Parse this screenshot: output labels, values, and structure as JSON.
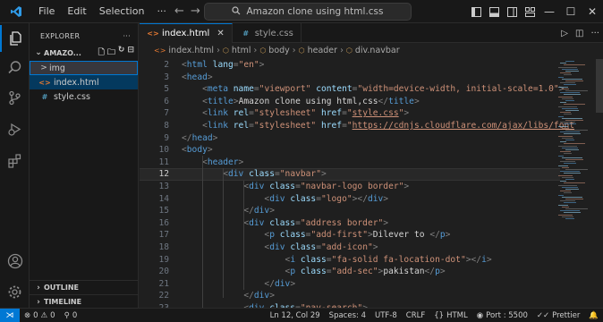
{
  "titlebar": {
    "menu": [
      "File",
      "Edit",
      "Selection"
    ],
    "more": "···",
    "search_text": "Amazon clone using html.css"
  },
  "sidebar": {
    "header": "EXPLORER",
    "more": "···",
    "folder": "AMAZO...",
    "tree": [
      {
        "label": "img",
        "type": "folder",
        "chevron": ">"
      },
      {
        "label": "index.html",
        "type": "html",
        "icon": "<>"
      },
      {
        "label": "style.css",
        "type": "css",
        "icon": "#"
      }
    ],
    "outline_label": "OUTLINE",
    "timeline_label": "TIMELINE"
  },
  "tabs": [
    {
      "label": "index.html",
      "icon": "<>",
      "active": true
    },
    {
      "label": "style.css",
      "icon": "#",
      "active": false
    }
  ],
  "breadcrumb": [
    "index.html",
    "html",
    "body",
    "header",
    "div.navbar"
  ],
  "code_lines": [
    {
      "n": "2",
      "tokens": [
        [
          "t",
          "<"
        ],
        [
          "g",
          "html "
        ],
        [
          "a",
          "lang"
        ],
        [
          "t",
          "="
        ],
        [
          "v",
          "\"en\""
        ],
        [
          "t",
          ">"
        ]
      ]
    },
    {
      "n": "3",
      "tokens": [
        [
          "t",
          "<"
        ],
        [
          "g",
          "head"
        ],
        [
          "t",
          ">"
        ]
      ]
    },
    {
      "n": "5",
      "tokens": [
        [
          "x",
          "    "
        ],
        [
          "t",
          "<"
        ],
        [
          "g",
          "meta "
        ],
        [
          "a",
          "name"
        ],
        [
          "t",
          "="
        ],
        [
          "v",
          "\"viewport\" "
        ],
        [
          "a",
          "content"
        ],
        [
          "t",
          "="
        ],
        [
          "v",
          "\"width=device-width, initial-scale=1.0\""
        ],
        [
          "t",
          ">"
        ]
      ]
    },
    {
      "n": "6",
      "tokens": [
        [
          "x",
          "    "
        ],
        [
          "t",
          "<"
        ],
        [
          "g",
          "title"
        ],
        [
          "t",
          ">"
        ],
        [
          "x",
          "Amazon clone using html,css"
        ],
        [
          "t",
          "</"
        ],
        [
          "g",
          "title"
        ],
        [
          "t",
          ">"
        ]
      ]
    },
    {
      "n": "7",
      "tokens": [
        [
          "x",
          "    "
        ],
        [
          "t",
          "<"
        ],
        [
          "g",
          "link "
        ],
        [
          "a",
          "rel"
        ],
        [
          "t",
          "="
        ],
        [
          "v",
          "\"stylesheet\" "
        ],
        [
          "a",
          "href"
        ],
        [
          "t",
          "="
        ],
        [
          "v",
          "\""
        ],
        [
          "l",
          "style.css"
        ],
        [
          "v",
          "\""
        ],
        [
          "t",
          ">"
        ]
      ]
    },
    {
      "n": "8",
      "tokens": [
        [
          "x",
          "    "
        ],
        [
          "t",
          "<"
        ],
        [
          "g",
          "link "
        ],
        [
          "a",
          "rel"
        ],
        [
          "t",
          "="
        ],
        [
          "v",
          "\"stylesheet\" "
        ],
        [
          "a",
          "href"
        ],
        [
          "t",
          "="
        ],
        [
          "v",
          "\""
        ],
        [
          "l",
          "https://cdnjs.cloudflare.com/ajax/libs/font"
        ]
      ]
    },
    {
      "n": "9",
      "tokens": [
        [
          "t",
          "</"
        ],
        [
          "g",
          "head"
        ],
        [
          "t",
          ">"
        ]
      ]
    },
    {
      "n": "10",
      "tokens": [
        [
          "t",
          "<"
        ],
        [
          "g",
          "body"
        ],
        [
          "t",
          ">"
        ]
      ]
    },
    {
      "n": "11",
      "tokens": [
        [
          "x",
          "    "
        ],
        [
          "t",
          "<"
        ],
        [
          "g",
          "header"
        ],
        [
          "t",
          ">"
        ]
      ]
    },
    {
      "n": "12",
      "tokens": [
        [
          "x",
          "        "
        ],
        [
          "t",
          "<"
        ],
        [
          "g",
          "div "
        ],
        [
          "a",
          "class"
        ],
        [
          "t",
          "="
        ],
        [
          "v",
          "\"navbar\""
        ],
        [
          "t",
          ">"
        ]
      ],
      "current": true
    },
    {
      "n": "13",
      "tokens": [
        [
          "x",
          "            "
        ],
        [
          "t",
          "<"
        ],
        [
          "g",
          "div "
        ],
        [
          "a",
          "class"
        ],
        [
          "t",
          "="
        ],
        [
          "v",
          "\"navbar-logo border\""
        ],
        [
          "t",
          ">"
        ]
      ]
    },
    {
      "n": "14",
      "tokens": [
        [
          "x",
          "                "
        ],
        [
          "t",
          "<"
        ],
        [
          "g",
          "div "
        ],
        [
          "a",
          "class"
        ],
        [
          "t",
          "="
        ],
        [
          "v",
          "\"logo\""
        ],
        [
          "t",
          "></"
        ],
        [
          "g",
          "div"
        ],
        [
          "t",
          ">"
        ]
      ]
    },
    {
      "n": "15",
      "tokens": [
        [
          "x",
          "            "
        ],
        [
          "t",
          "</"
        ],
        [
          "g",
          "div"
        ],
        [
          "t",
          ">"
        ]
      ]
    },
    {
      "n": "16",
      "tokens": [
        [
          "x",
          "            "
        ],
        [
          "t",
          "<"
        ],
        [
          "g",
          "div "
        ],
        [
          "a",
          "class"
        ],
        [
          "t",
          "="
        ],
        [
          "v",
          "\"address border\""
        ],
        [
          "t",
          ">"
        ]
      ]
    },
    {
      "n": "17",
      "tokens": [
        [
          "x",
          "                "
        ],
        [
          "t",
          "<"
        ],
        [
          "g",
          "p "
        ],
        [
          "a",
          "class"
        ],
        [
          "t",
          "="
        ],
        [
          "v",
          "\"add-first\""
        ],
        [
          "t",
          ">"
        ],
        [
          "x",
          "Dilever to "
        ],
        [
          "t",
          "</"
        ],
        [
          "g",
          "p"
        ],
        [
          "t",
          ">"
        ]
      ]
    },
    {
      "n": "18",
      "tokens": [
        [
          "x",
          "                "
        ],
        [
          "t",
          "<"
        ],
        [
          "g",
          "div "
        ],
        [
          "a",
          "class"
        ],
        [
          "t",
          "="
        ],
        [
          "v",
          "\"add-icon\""
        ],
        [
          "t",
          ">"
        ]
      ]
    },
    {
      "n": "19",
      "tokens": [
        [
          "x",
          "                    "
        ],
        [
          "t",
          "<"
        ],
        [
          "g",
          "i "
        ],
        [
          "a",
          "class"
        ],
        [
          "t",
          "="
        ],
        [
          "v",
          "\"fa-solid fa-location-dot\""
        ],
        [
          "t",
          "></"
        ],
        [
          "g",
          "i"
        ],
        [
          "t",
          ">"
        ]
      ]
    },
    {
      "n": "20",
      "tokens": [
        [
          "x",
          "                    "
        ],
        [
          "t",
          "<"
        ],
        [
          "g",
          "p "
        ],
        [
          "a",
          "class"
        ],
        [
          "t",
          "="
        ],
        [
          "v",
          "\"add-sec\""
        ],
        [
          "t",
          ">"
        ],
        [
          "x",
          "pakistan"
        ],
        [
          "t",
          "</"
        ],
        [
          "g",
          "p"
        ],
        [
          "t",
          ">"
        ]
      ]
    },
    {
      "n": "21",
      "tokens": [
        [
          "x",
          "                "
        ],
        [
          "t",
          "</"
        ],
        [
          "g",
          "div"
        ],
        [
          "t",
          ">"
        ]
      ]
    },
    {
      "n": "22",
      "tokens": [
        [
          "x",
          "            "
        ],
        [
          "t",
          "</"
        ],
        [
          "g",
          "div"
        ],
        [
          "t",
          ">"
        ]
      ]
    },
    {
      "n": "23",
      "tokens": [
        [
          "x",
          "            "
        ],
        [
          "t",
          "<"
        ],
        [
          "g",
          "div "
        ],
        [
          "a",
          "class"
        ],
        [
          "t",
          "="
        ],
        [
          "v",
          "\"nav-search\""
        ],
        [
          "t",
          ">"
        ]
      ]
    }
  ],
  "statusbar": {
    "errors": "0",
    "warnings": "0",
    "ports": "0",
    "position": "Ln 12, Col 29",
    "spaces": "Spaces: 4",
    "encoding": "UTF-8",
    "eol": "CRLF",
    "language": "HTML",
    "port": "Port : 5500",
    "prettier": "Prettier"
  },
  "colors": {
    "accent": "#0078d4",
    "tag": "#569cd6",
    "attribute": "#9cdcfe",
    "string": "#ce9178",
    "html_icon": "#e37933",
    "css_icon": "#519aba"
  }
}
